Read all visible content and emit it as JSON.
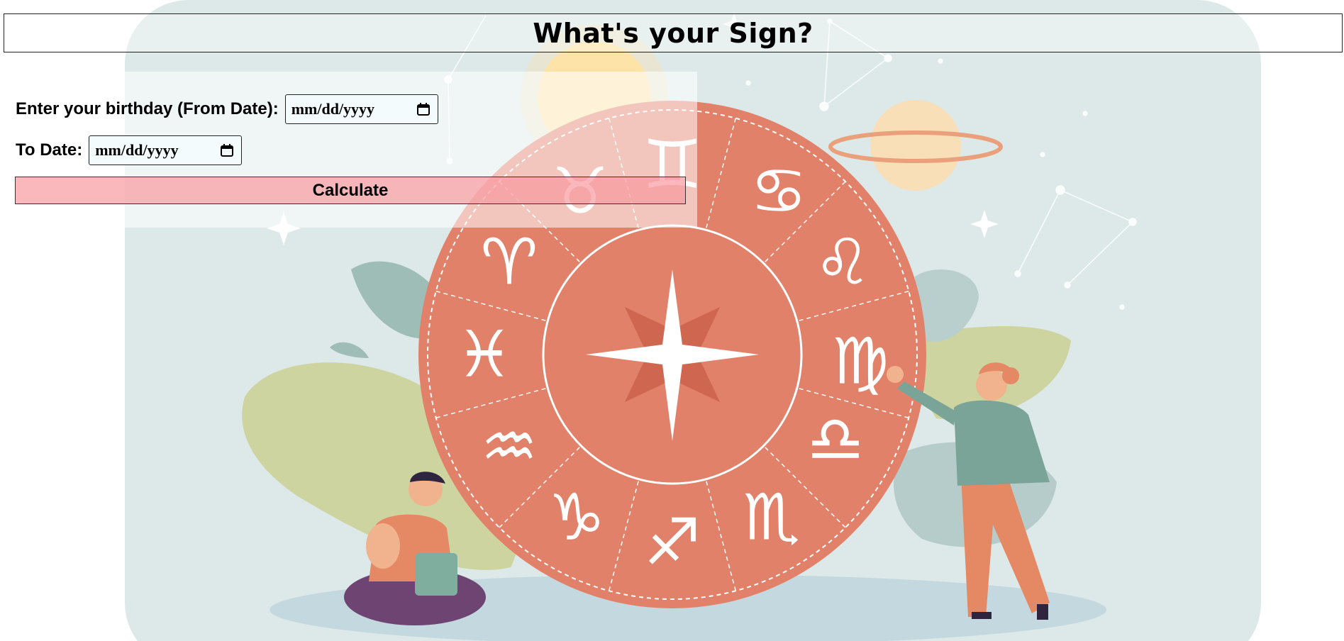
{
  "header": {
    "title": "What's your Sign?"
  },
  "form": {
    "from_label": "Enter your birthday (From Date):",
    "from_placeholder": "mm/dd/yyyy",
    "to_label": "To Date:",
    "to_placeholder": "mm/dd/yyyy",
    "calculate_label": "Calculate"
  },
  "icons": {
    "from_calendar": "calendar-icon",
    "to_calendar": "calendar-icon"
  },
  "colors": {
    "wheel": "#e2816a",
    "background": "#dde9e8",
    "button": "#f7969c"
  }
}
